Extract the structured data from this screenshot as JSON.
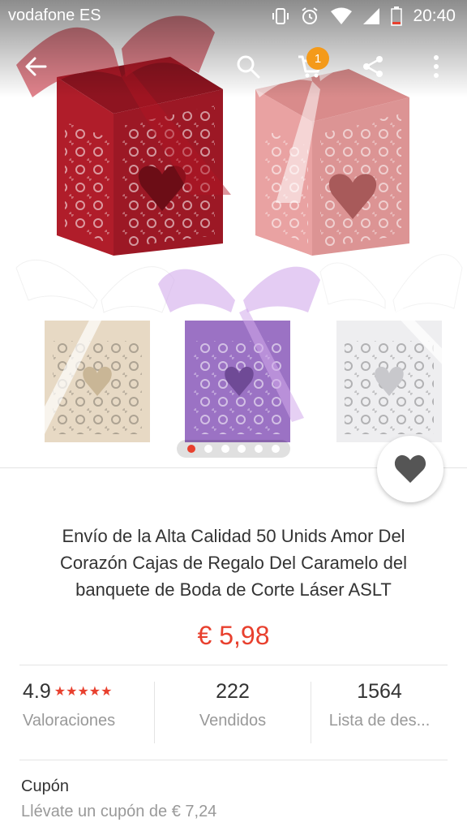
{
  "status_bar": {
    "carrier": "vodafone ES",
    "time": "20:40"
  },
  "toolbar": {
    "cart_count": "1"
  },
  "gallery": {
    "page_count": 6,
    "active_index": 0,
    "box_colors": [
      "#b01d2a",
      "#e9a2a2",
      "#e7d9c4",
      "#9b72c4",
      "#eeeef0"
    ]
  },
  "product": {
    "title": "Envío de la Alta Calidad 50 Unids Amor Del Corazón Cajas de Regalo Del Caramelo del banquete de Boda de Corte Láser ASLT",
    "price": "€ 5,98"
  },
  "stats": {
    "rating_value": "4.9",
    "rating_stars": "★★★★★",
    "rating_label": "Valoraciones",
    "sold_value": "222",
    "sold_label": "Vendidos",
    "wishlist_value": "1564",
    "wishlist_label": "Lista de des..."
  },
  "coupon": {
    "title": "Cupón",
    "subtitle": "Llévate un cupón de € 7,24"
  },
  "colors": {
    "accent": "#e8402e",
    "badge": "#f49a1a",
    "text": "#333333",
    "muted": "#999999"
  }
}
